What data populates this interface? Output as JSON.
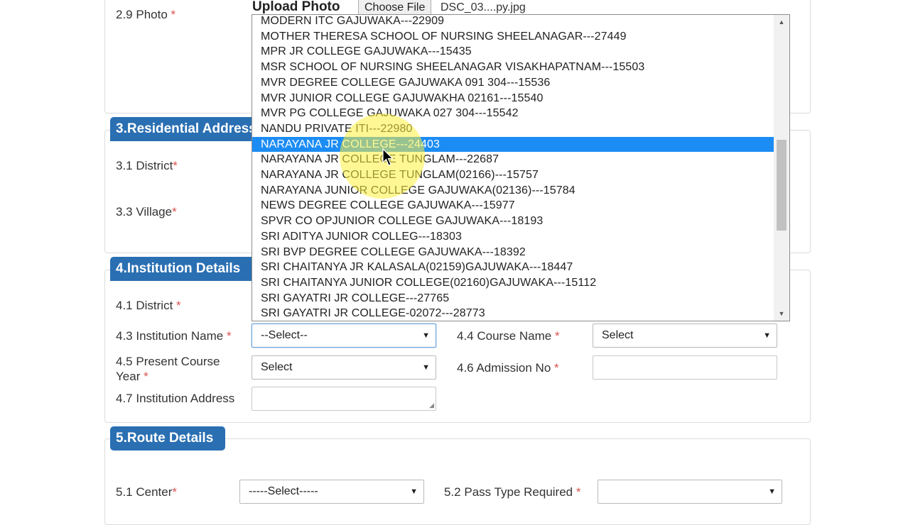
{
  "photo": {
    "label": "2.9 Photo",
    "required_mark": "*",
    "upload_title": "Upload Photo",
    "choose_file": "Choose File",
    "file_name": "DSC_03....py.jpg"
  },
  "residential": {
    "header": "3.Residential Address",
    "district_label": "3.1 District",
    "village_label": "3.3 Village",
    "required_mark": "*"
  },
  "institution": {
    "header": "4.Institution Details",
    "district_label": "4.1 District",
    "name_label": "4.3 Institution Name",
    "name_value": "--Select--",
    "course_label": "4.4 Course Name",
    "course_value": "Select",
    "year_label_line1": "4.5 Present Course",
    "year_label_line2": "Year",
    "year_value": "Select",
    "admission_label": "4.6 Admission No",
    "address_label": "4.7 Institution Address",
    "required_mark": "*"
  },
  "route": {
    "header": "5.Route Details",
    "center_label": "5.1 Center",
    "center_value": "-----Select-----",
    "pass_label": "5.2 Pass Type Required",
    "pass_value": "",
    "required_mark": "*"
  },
  "dropdown_options": [
    "MODERN ITC GAJUWAKA---22909",
    "MOTHER THERESA SCHOOL OF NURSING SHEELANAGAR---27449",
    "MPR JR COLLEGE GAJUWAKA---15435",
    "MSR SCHOOL OF NURSING SHEELANAGAR VISAKHAPATNAM---15503",
    "MVR DEGREE COLLEGE GAJUWAKA 091 304---15536",
    "MVR JUNIOR COLLEGE GAJUWAKHA 02161---15540",
    "MVR PG COLLEGE GAJUWAKA 027 304---15542",
    "NANDU PRIVATE ITI---22980",
    "NARAYANA JR COLLEGE---24403",
    "NARAYANA JR COLLEGE TUNGLAM---22687",
    "NARAYANA JR COLLEGE TUNGLAM(02166)---15757",
    "NARAYANA JUNIOR COLLEGE GAJUWAKA(02136)---15784",
    "NEWS DEGREE COLLEGE GAJUWAKA---15977",
    "SPVR CO OPJUNIOR COLLEGE GAJUWAKA---18193",
    "SRI ADITYA JUNIOR COLLEG---18303",
    "SRI BVP DEGREE COLLEGE GAJUWAKA---18392",
    "SRI CHAITANYA JR KALASALA(02159)GAJUWAKA---18447",
    "SRI CHAITANYA JUNIOR COLLEGE(02160)GAJUWAKA---15112",
    "SRI GAYATRI JR COLLEGE---27765",
    "SRI GAYATRI JR COLLEGE-02072---28773"
  ],
  "selected_option": "NARAYANA JR COLLEGE---24403",
  "colors": {
    "header_bg": "#2a6fb2",
    "selected_bg": "#1c8cf5",
    "required": "#d9534f"
  }
}
